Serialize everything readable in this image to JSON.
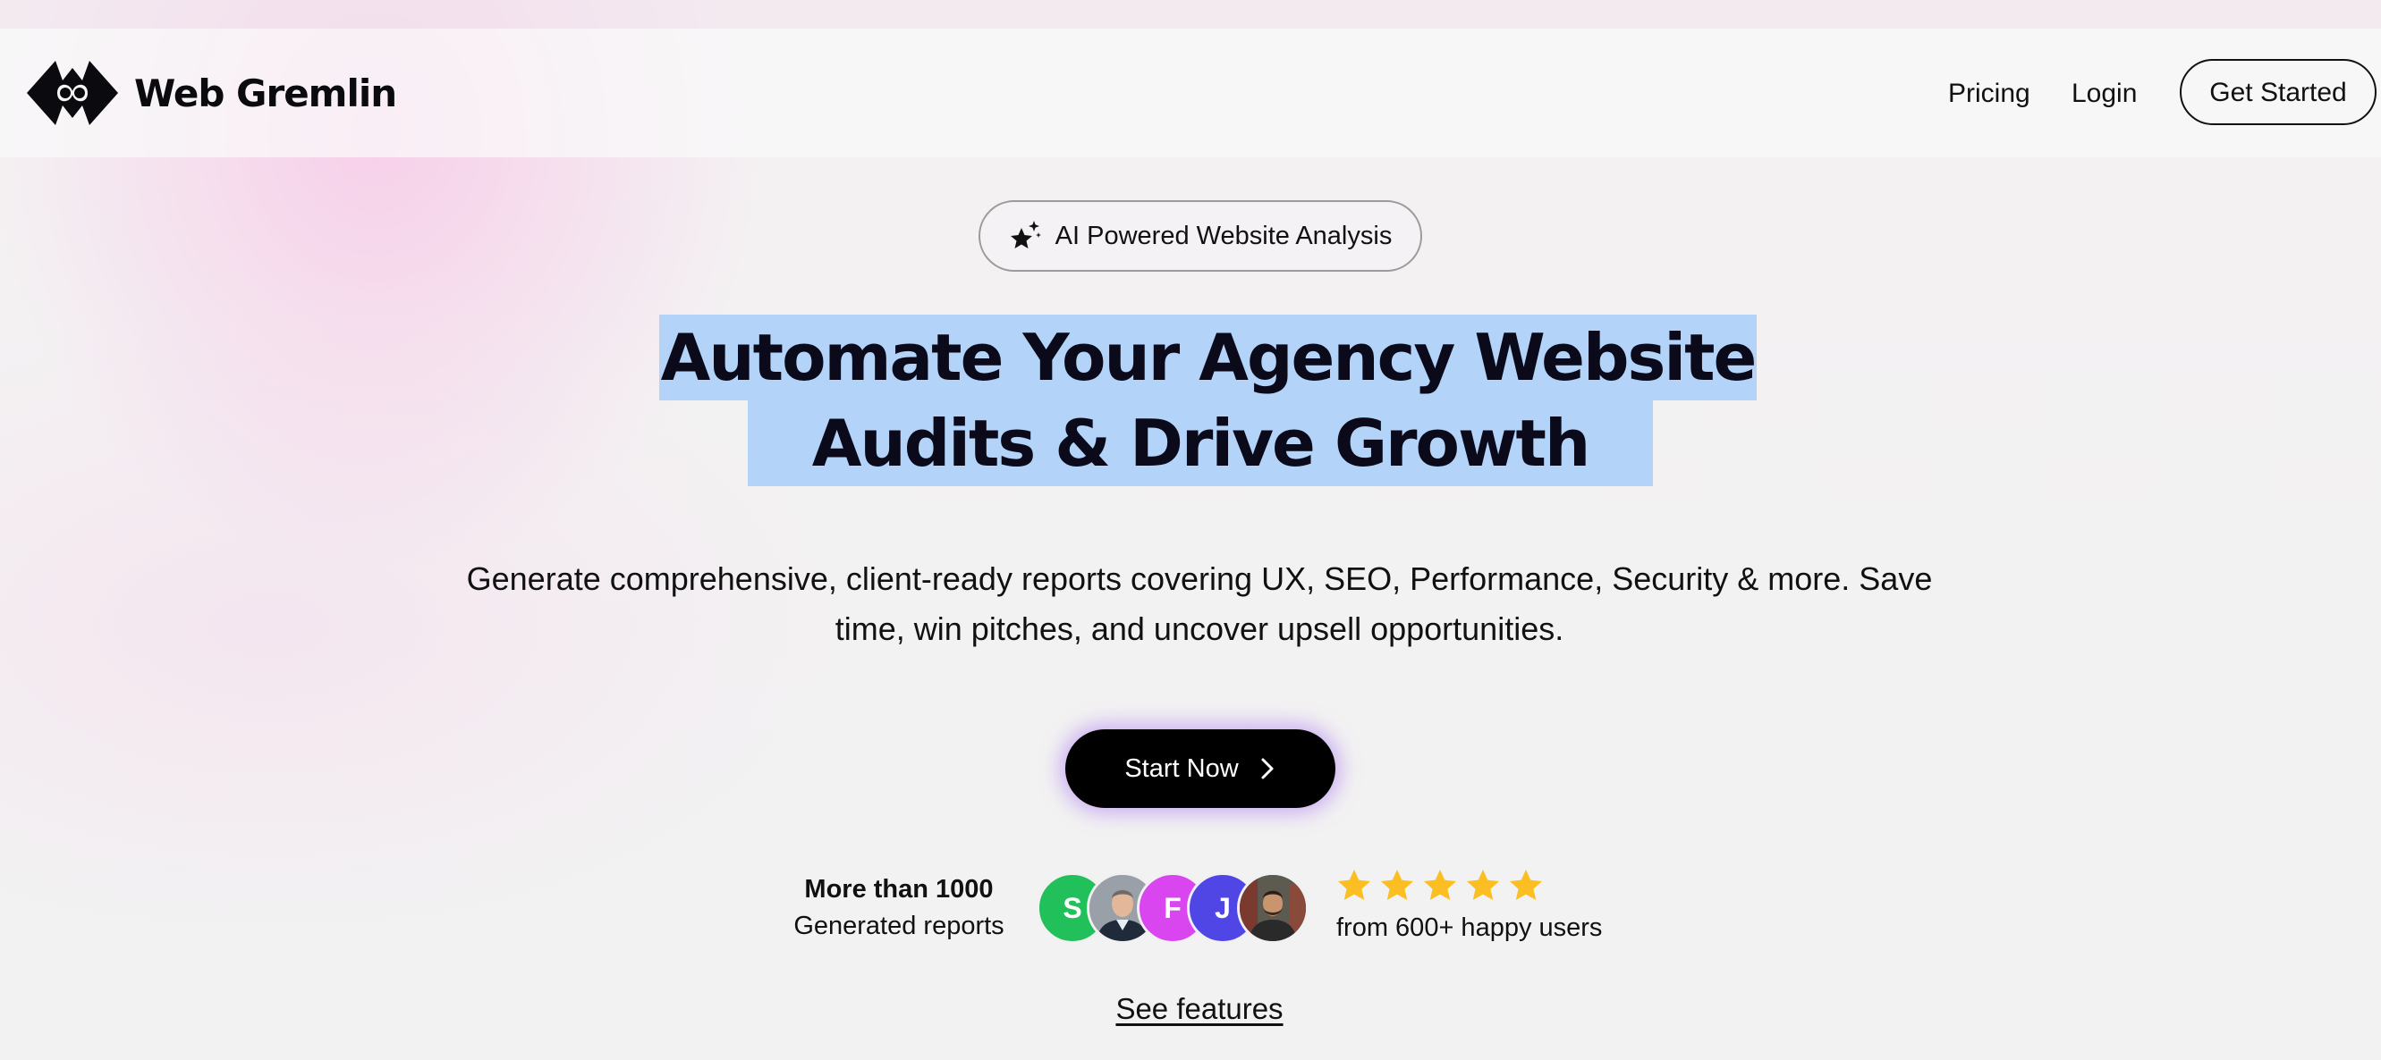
{
  "brand": {
    "name": "Web Gremlin",
    "logo_icon": "web-gremlin-logo-icon"
  },
  "nav": {
    "pricing_label": "Pricing",
    "login_label": "Login",
    "get_started_label": "Get Started"
  },
  "hero": {
    "badge_icon": "sparkle-star-icon",
    "badge_text": "AI Powered Website Analysis",
    "headline_line1": "Automate Your Agency Website",
    "headline_line2": "Audits & Drive Growth",
    "subtitle_line1": "Generate comprehensive, client-ready reports covering UX, SEO, Performance, Security & more. Save",
    "subtitle_line2": "time, win pitches, and uncover upsell opportunities.",
    "cta_label": "Start Now",
    "cta_icon": "chevron-right-icon"
  },
  "social_proof": {
    "count_label": "More than 1000",
    "count_sub": "Generated reports",
    "avatars": [
      {
        "initial": "S",
        "color": "#22c05a",
        "kind": "letter"
      },
      {
        "initial": "",
        "color": "#8c9096",
        "kind": "photo"
      },
      {
        "initial": "F",
        "color": "#d946ef",
        "kind": "letter"
      },
      {
        "initial": "J",
        "color": "#4f46e5",
        "kind": "letter"
      },
      {
        "initial": "",
        "color": "#6b5a4a",
        "kind": "photo"
      }
    ],
    "stars": 5,
    "star_color": "#fbbf24",
    "rating_text": "from 600+ happy users"
  },
  "footer_link": {
    "see_features_label": "See features"
  },
  "colors": {
    "headline_highlight": "#b3d3f8",
    "cta_background": "#000000",
    "cta_glow": "#aa78f0",
    "page_background": "#f1f1f1",
    "glow_pink": "#f8c4e6"
  }
}
